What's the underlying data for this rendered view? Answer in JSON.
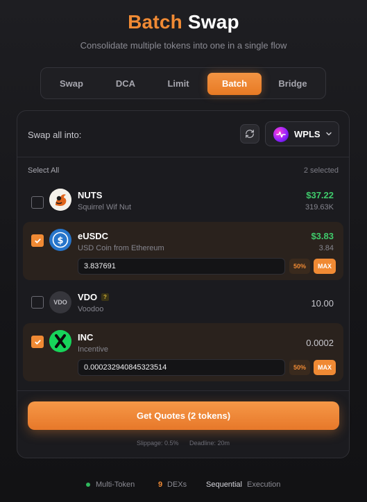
{
  "header": {
    "title_accent": "Batch",
    "title_rest": "Swap",
    "subtitle": "Consolidate multiple tokens into one in a single flow"
  },
  "tabs": [
    {
      "label": "Swap",
      "active": false
    },
    {
      "label": "DCA",
      "active": false
    },
    {
      "label": "Limit",
      "active": false
    },
    {
      "label": "Batch",
      "active": true
    },
    {
      "label": "Bridge",
      "active": false
    }
  ],
  "card": {
    "swap_into_label": "Swap all into:",
    "target_token": "WPLS",
    "select_all": "Select All",
    "selected_count": "2 selected"
  },
  "tokens": [
    {
      "symbol": "NUTS",
      "name": "Squirrel Wif Nut",
      "usd": "$37.22",
      "amount": "319.63K",
      "selected": false
    },
    {
      "symbol": "eUSDC",
      "name": "USD Coin from Ethereum",
      "usd": "$3.83",
      "amount": "3.84",
      "selected": true,
      "input_value": "3.837691",
      "pct_label": "50%",
      "max_label": "MAX"
    },
    {
      "symbol": "VDO",
      "logo_text": "VDO",
      "name": "Voodoo",
      "amount": "10.00",
      "unverified_badge": "?",
      "selected": false
    },
    {
      "symbol": "INC",
      "name": "Incentive",
      "amount": "0.0002",
      "selected": true,
      "input_value": "0.000232940845323514",
      "pct_label": "50%",
      "max_label": "MAX"
    }
  ],
  "actions": {
    "get_quotes_label": "Get Quotes (2 tokens)",
    "slippage": "Slippage: 0.5%",
    "deadline": "Deadline: 20m"
  },
  "footer": {
    "multi_token": "Multi-Token",
    "dex_count": "9",
    "dex_label": "DEXs",
    "sequential": "Sequential",
    "execution": "Execution"
  },
  "colors": {
    "accent": "#f08a34",
    "positive": "#3fca6b",
    "background": "#151518",
    "card": "#1b1b1f"
  }
}
